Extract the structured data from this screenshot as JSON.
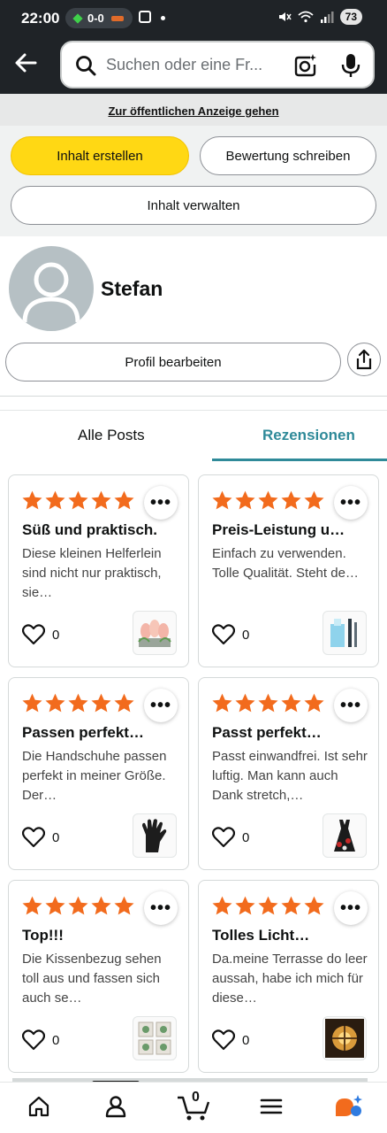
{
  "status_bar": {
    "time": "22:00",
    "pill_text": "0-0",
    "battery": "73"
  },
  "search": {
    "placeholder": "Suchen oder eine Fr..."
  },
  "public_link": "Zur öffentlichen Anzeige gehen",
  "actions": {
    "create": "Inhalt erstellen",
    "review": "Bewertung schreiben",
    "manage": "Inhalt verwalten"
  },
  "profile": {
    "name": "Stefan",
    "edit": "Profil bearbeiten"
  },
  "tabs": {
    "all": "Alle Posts",
    "reviews": "Rezensionen",
    "active": "Rezensionen"
  },
  "reviews": [
    {
      "title": "Süß und praktisch.",
      "body": "Diese kleinen Helferlein sind nicht nur praktisch, sie…",
      "likes": "0",
      "rating": 5,
      "thumb": "pink-flower-holders"
    },
    {
      "title": "Preis-Leistung u…",
      "body": "Einfach zu verwenden. Tolle Qualität. Steht de…",
      "likes": "0",
      "rating": 5,
      "thumb": "blue-cleaning-tools"
    },
    {
      "title": "Passen perfekt…",
      "body": "Die Handschuhe passen perfekt in meiner Größe. Der…",
      "likes": "0",
      "rating": 5,
      "thumb": "black-gloves"
    },
    {
      "title": "Passt perfekt…",
      "body": "Passt einwandfrei. Ist sehr luftig. Man kann auch Dank stretch,…",
      "likes": "0",
      "rating": 5,
      "thumb": "red-black-dress"
    },
    {
      "title": "Top!!!",
      "body": "Die Kissenbezug sehen toll aus und fassen sich auch se…",
      "likes": "0",
      "rating": 5,
      "thumb": "cushion-covers"
    },
    {
      "title": "Tolles Licht…",
      "body": "Da.meine Terrasse do leer aussah, habe ich mich für diese…",
      "likes": "0",
      "rating": 5,
      "thumb": "lantern-light"
    }
  ],
  "more_label": "•••",
  "nav": {
    "cart_count": "0"
  },
  "colors": {
    "accent_teal": "#2f8a99",
    "star_orange": "#f26b1d",
    "button_yellow": "#ffd814",
    "header_dark": "#1f2327"
  }
}
